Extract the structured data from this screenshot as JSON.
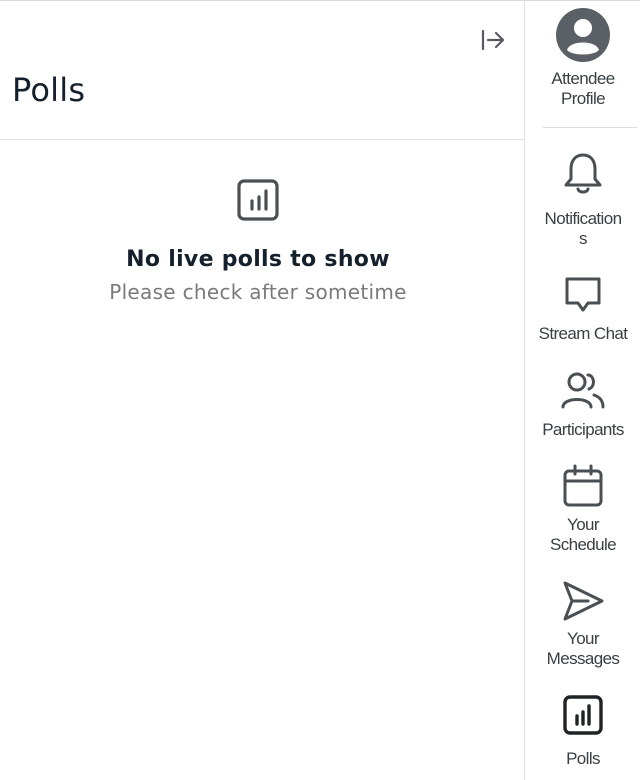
{
  "panel": {
    "title": "Polls",
    "collapse_icon": "collapse-right-icon"
  },
  "empty_state": {
    "icon": "poll-chart-icon",
    "title": "No live polls to show",
    "subtitle": "Please check after sometime"
  },
  "rail": {
    "profile": {
      "label": "Attendee\nProfile",
      "icon": "avatar-icon"
    },
    "items": [
      {
        "label": "Notification\ns",
        "icon": "bell-icon"
      },
      {
        "label": "Stream Chat",
        "icon": "chat-bubble-icon"
      },
      {
        "label": "Participants",
        "icon": "people-icon"
      },
      {
        "label": "Your\nSchedule",
        "icon": "calendar-icon"
      },
      {
        "label": "Your\nMessages",
        "icon": "send-icon"
      },
      {
        "label": "Polls",
        "icon": "poll-chart-icon"
      }
    ]
  },
  "colors": {
    "icon": "#4a4f54",
    "title": "#14202b",
    "subtitle": "#7a7a7a",
    "divider": "#e2e2e2"
  }
}
